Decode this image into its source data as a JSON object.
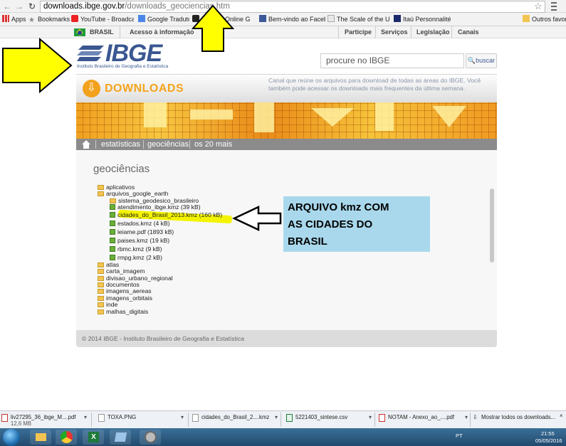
{
  "browser": {
    "url_host": "downloads.ibge.gov.br",
    "url_path": "/downloads_geociencias.htm",
    "bookmarks": [
      "Apps",
      "Bookmarks",
      "YouTube - Broadcast",
      "Google Tradutor",
      "Ba",
      "ll - Online G",
      "Bem-vindo ao Facebo",
      "The Scale of the Unive",
      "Itaú Personnalité",
      "Outros favoritos"
    ]
  },
  "govbar": {
    "country": "BRASIL",
    "access": "Acesso à informação",
    "links": [
      "Participe",
      "Serviços",
      "Legislação",
      "Canais"
    ]
  },
  "header": {
    "logo_text": "IBGE",
    "logo_sub": "Instituto Brasileiro de Geografia e Estatística",
    "search_placeholder": "procure no IBGE",
    "search_button": "buscar"
  },
  "downloads": {
    "title": "DOWNLOADS",
    "description": "Canal que reúne os arquivos para download de todas as áreas do IBGE. Você também pode acessar os downloads mais frequentes da última semana."
  },
  "subnav": [
    "estatísticas",
    "geociências",
    "os 20 mais"
  ],
  "section_title": "geociências",
  "tree": {
    "aplicativos": "aplicativos",
    "arquivos_google_earth": "arquivos_google_earth",
    "sistema": "sistema_geodesico_brasileiro",
    "files": [
      "atendimento_ibge.kmz (39 kB)",
      "cidades_do_Brasil_2013.kmz (160 kB)",
      "estados.kmz (4 kB)",
      "leiame.pdf (1893 kB)",
      "paises.kmz (19 kB)",
      "rbmc.kmz (9 kB)",
      "rmpg.kmz (2 kB)"
    ],
    "folders": [
      "atlas",
      "carta_imagem",
      "divisao_urbano_regional",
      "documentos",
      "imagens_aereas",
      "imagens_orbitais",
      "inde",
      "malhas_digitais"
    ]
  },
  "footer": "© 2014 IBGE - Instituto Brasileiro de Geografia e Estatística",
  "annotation": [
    "ARQUIVO kmz COM",
    "AS CIDADES DO",
    "BRASIL"
  ],
  "download_shelf": {
    "items": [
      {
        "name": "liv27295_36_ibge_M....pdf",
        "size": "12,6 MB"
      },
      {
        "name": "TOXA.PNG",
        "size": ""
      },
      {
        "name": "cidades_do_Brasil_2....kmz",
        "size": ""
      },
      {
        "name": "5221403_sintese.csv",
        "size": ""
      },
      {
        "name": "NOTAM - Anexo_ao_....pdf",
        "size": ""
      }
    ],
    "show_all": "Mostrar todos os downloads..."
  },
  "taskbar": {
    "lang": "PT",
    "time": "21:55",
    "date": "05/05/2016"
  },
  "colors": {
    "ibge_blue": "#3a5791",
    "orange": "#f5a41c",
    "highlight": "#f4f400",
    "annotation_bg": "#a9d8ec",
    "arrow_yellow": "#ffff00"
  }
}
